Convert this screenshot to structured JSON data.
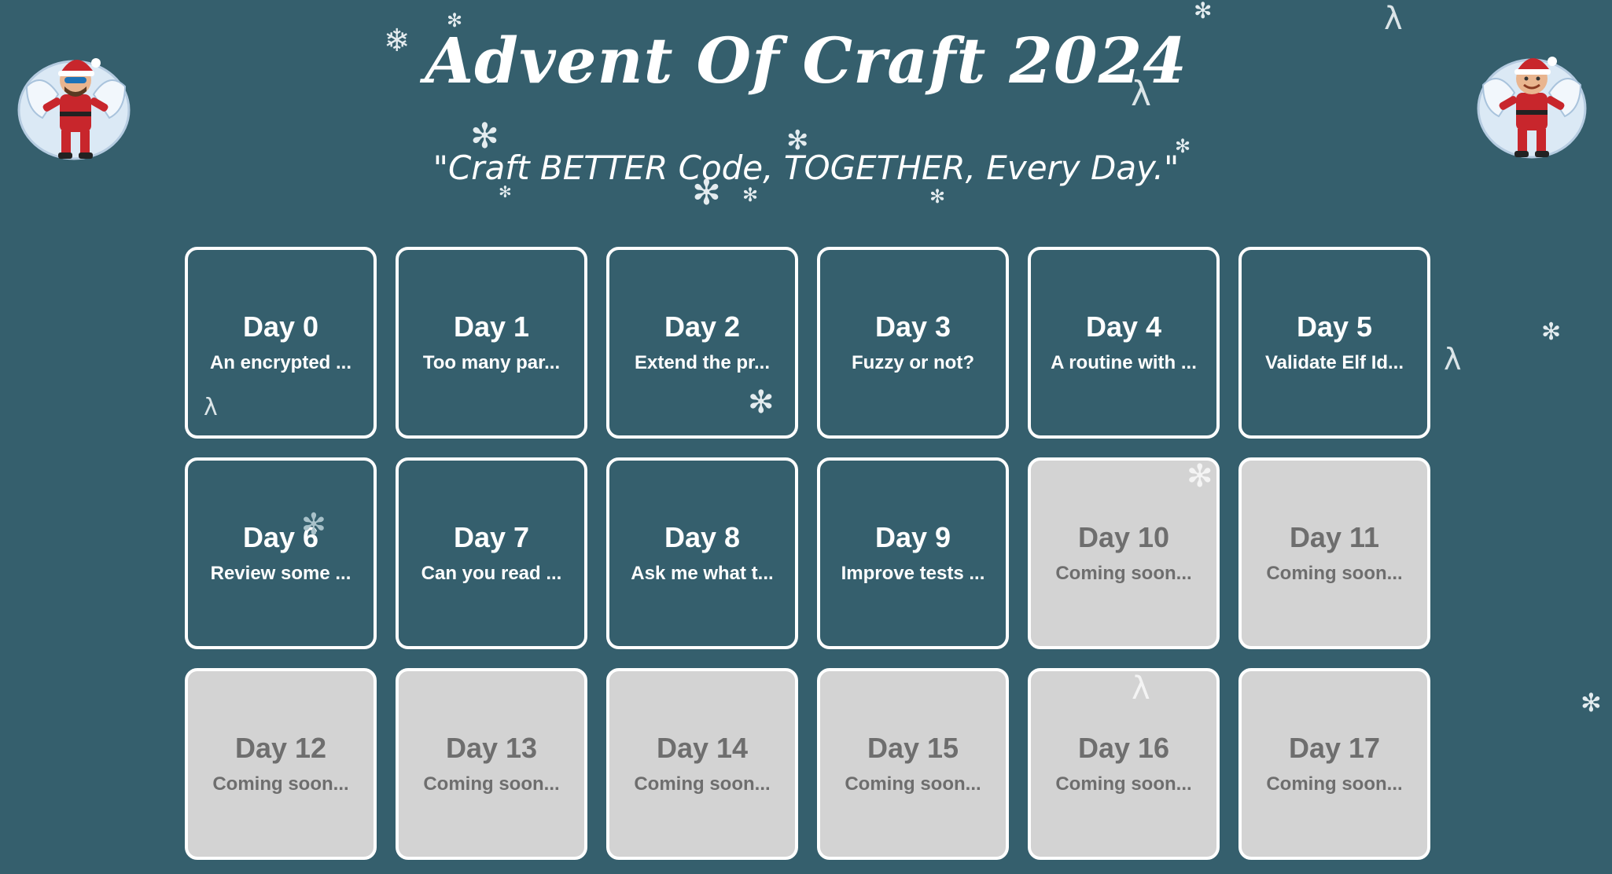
{
  "header": {
    "title": "Advent Of Craft 2024",
    "subtitle": "\"Craft BETTER Code, TOGETHER, Every Day.\""
  },
  "days": [
    {
      "day": "Day 0",
      "desc": "An encrypted ...",
      "locked": false
    },
    {
      "day": "Day 1",
      "desc": "Too many par...",
      "locked": false
    },
    {
      "day": "Day 2",
      "desc": "Extend the pr...",
      "locked": false
    },
    {
      "day": "Day 3",
      "desc": "Fuzzy or not?",
      "locked": false
    },
    {
      "day": "Day 4",
      "desc": "A routine with ...",
      "locked": false
    },
    {
      "day": "Day 5",
      "desc": "Validate Elf Id...",
      "locked": false
    },
    {
      "day": "Day 6",
      "desc": "Review some ...",
      "locked": false
    },
    {
      "day": "Day 7",
      "desc": "Can you read ...",
      "locked": false
    },
    {
      "day": "Day 8",
      "desc": "Ask me what t...",
      "locked": false
    },
    {
      "day": "Day 9",
      "desc": "Improve tests ...",
      "locked": false
    },
    {
      "day": "Day 10",
      "desc": "Coming soon...",
      "locked": true
    },
    {
      "day": "Day 11",
      "desc": "Coming soon...",
      "locked": true
    },
    {
      "day": "Day 12",
      "desc": "Coming soon...",
      "locked": true
    },
    {
      "day": "Day 13",
      "desc": "Coming soon...",
      "locked": true
    },
    {
      "day": "Day 14",
      "desc": "Coming soon...",
      "locked": true
    },
    {
      "day": "Day 15",
      "desc": "Coming soon...",
      "locked": true
    },
    {
      "day": "Day 16",
      "desc": "Coming soon...",
      "locked": true
    },
    {
      "day": "Day 17",
      "desc": "Coming soon...",
      "locked": true
    }
  ],
  "decorations": {
    "snowflake_glyph": "✻",
    "snowflake_alt_glyph": "❄",
    "lambda_glyph": "λ",
    "left_avatar_icon": "snow-angel-santa-icon",
    "right_avatar_icon": "snow-angel-santa-icon"
  },
  "colors": {
    "background": "#355f6d",
    "card_border": "#ffffff",
    "card_locked_bg": "#d3d3d3",
    "card_locked_text": "#6e6e6e",
    "text": "#ffffff"
  }
}
